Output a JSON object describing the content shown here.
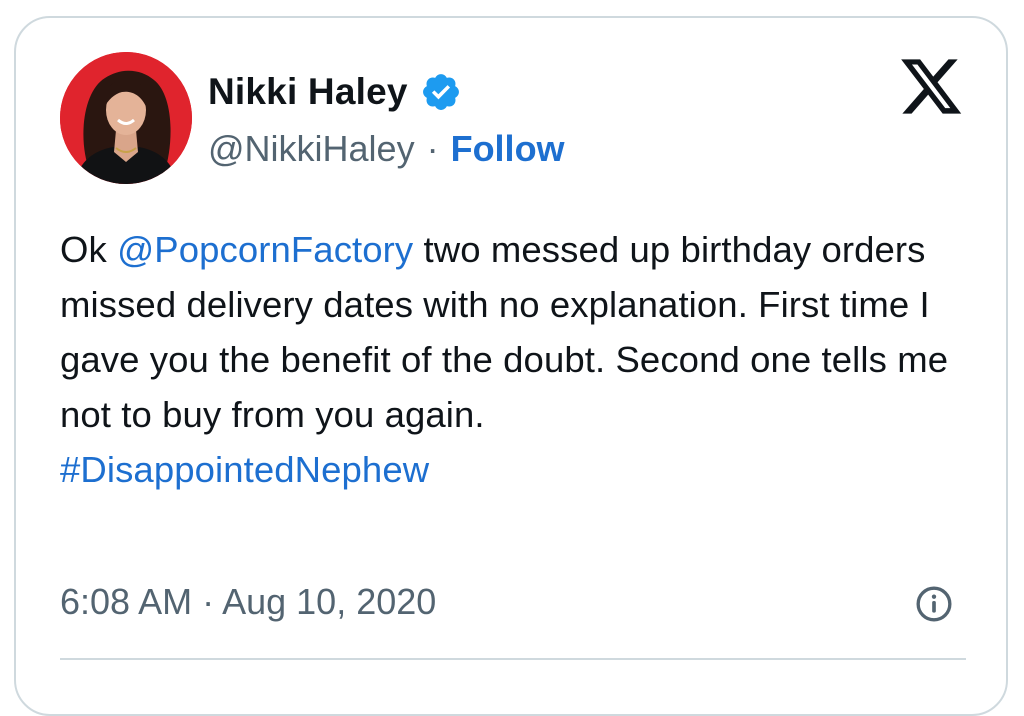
{
  "author": {
    "name": "Nikki Haley",
    "handle": "@NikkiHaley",
    "separator": "·",
    "follow_label": "Follow",
    "verified": true
  },
  "tweet": {
    "text_prefix": "Ok ",
    "mention": "@PopcornFactory",
    "text_body": " two messed up birthday orders missed delivery dates with no explanation. First time I gave you the benefit of the doubt. Second one tells me not to buy from you again.",
    "hashtag": "#DisappointedNephew"
  },
  "meta": {
    "timestamp": "6:08 AM · Aug 10, 2020"
  },
  "icons": {
    "platform": "x-logo-icon",
    "verified": "verified-badge-icon",
    "info": "info-icon"
  },
  "colors": {
    "link": "#1d6fd0",
    "secondary_text": "#536471",
    "primary_text": "#0f1419",
    "avatar_background": "#e0242d",
    "border": "#cfd9de"
  }
}
